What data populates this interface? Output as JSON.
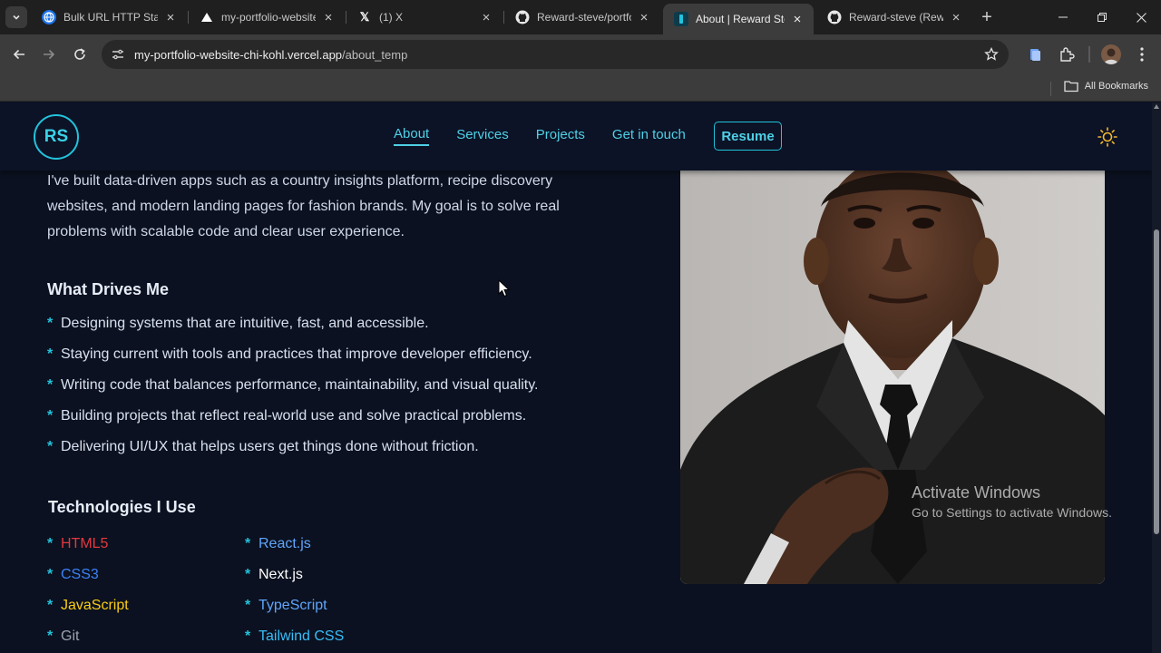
{
  "browser": {
    "tabs": [
      {
        "title": "Bulk URL HTTP Status",
        "active": false
      },
      {
        "title": "my-portfolio-website",
        "active": false
      },
      {
        "title": "(1) X",
        "active": false
      },
      {
        "title": "Reward-steve/portfol",
        "active": false
      },
      {
        "title": "About | Reward Step",
        "active": true
      },
      {
        "title": "Reward-steve (Rewar",
        "active": false
      }
    ],
    "url_host": "my-portfolio-website-chi-kohl.vercel.app",
    "url_path": "/about_temp",
    "bookmarks_label": "All Bookmarks"
  },
  "site": {
    "logo": "RS",
    "nav": [
      {
        "label": "About",
        "active": true
      },
      {
        "label": "Services",
        "active": false
      },
      {
        "label": "Projects",
        "active": false
      },
      {
        "label": "Get in touch",
        "active": false
      }
    ],
    "resume_label": "Resume",
    "intro": "I've built data-driven apps such as a country insights platform, recipe discovery websites, and modern landing pages for fashion brands. My goal is to solve real problems with scalable code and clear user experience.",
    "drives_heading": "What Drives Me",
    "drives": [
      "Designing systems that are intuitive, fast, and accessible.",
      "Staying current with tools and practices that improve developer efficiency.",
      "Writing code that balances performance, maintainability, and visual quality.",
      "Building projects that reflect real-world use and solve practical problems.",
      "Delivering UI/UX that helps users get things done without friction."
    ],
    "tech_heading": "Technologies I Use",
    "tech_col1": [
      {
        "name": "HTML5",
        "color": "#e3383e"
      },
      {
        "name": "CSS3",
        "color": "#3b82f6"
      },
      {
        "name": "JavaScript",
        "color": "#facc15"
      },
      {
        "name": "Git",
        "color": "#9ca3af"
      }
    ],
    "tech_col2": [
      {
        "name": "React.js",
        "color": "#60a5fa"
      },
      {
        "name": "Next.js",
        "color": "#ffffff"
      },
      {
        "name": "TypeScript",
        "color": "#60a5fa"
      },
      {
        "name": "Tailwind CSS",
        "color": "#38bdf8"
      }
    ],
    "accent": "#22c3dc"
  },
  "overlay": {
    "activate_title": "Activate Windows",
    "activate_sub": "Go to Settings to activate Windows."
  }
}
